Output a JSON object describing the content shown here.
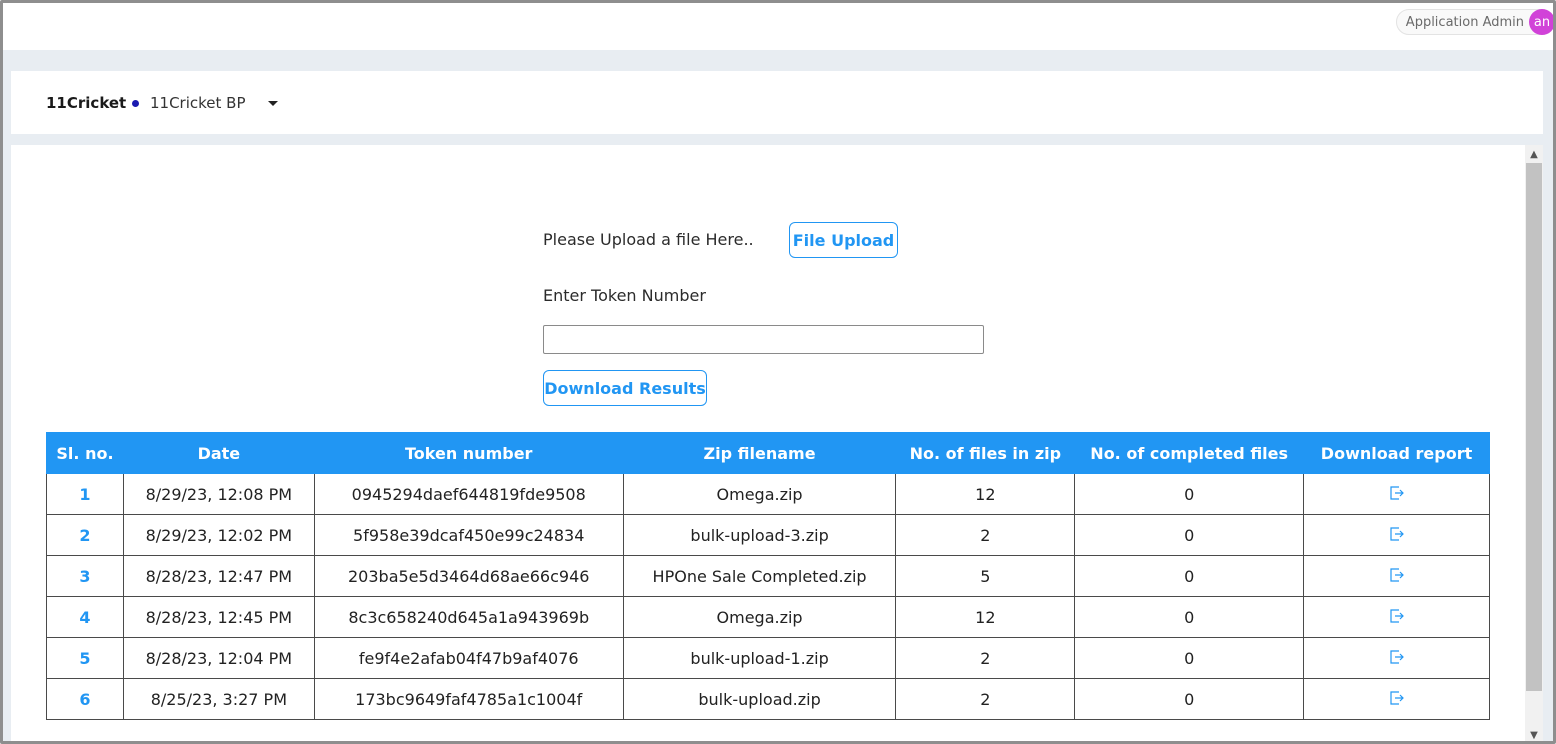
{
  "header": {
    "user_name": "Application Admin",
    "avatar_initials": "an"
  },
  "selector": {
    "brand": "11Cricket",
    "selected_bp": "11Cricket BP"
  },
  "upload": {
    "label": "Please Upload a file Here..",
    "button_label": "File Upload"
  },
  "token": {
    "label": "Enter Token Number",
    "value": "",
    "download_button_label": "Download Results"
  },
  "table": {
    "columns": [
      "Sl. no.",
      "Date",
      "Token number",
      "Zip filename",
      "No. of files in zip",
      "No. of completed files",
      "Download report"
    ],
    "rows": [
      {
        "sl": "1",
        "date": "8/29/23, 12:08 PM",
        "token": "0945294daef644819fde9508",
        "zip": "Omega.zip",
        "files": "12",
        "completed": "0"
      },
      {
        "sl": "2",
        "date": "8/29/23, 12:02 PM",
        "token": "5f958e39dcaf450e99c24834",
        "zip": "bulk-upload-3.zip",
        "files": "2",
        "completed": "0"
      },
      {
        "sl": "3",
        "date": "8/28/23, 12:47 PM",
        "token": "203ba5e5d3464d68ae66c946",
        "zip": "HPOne Sale Completed.zip",
        "files": "5",
        "completed": "0"
      },
      {
        "sl": "4",
        "date": "8/28/23, 12:45 PM",
        "token": "8c3c658240d645a1a943969b",
        "zip": "Omega.zip",
        "files": "12",
        "completed": "0"
      },
      {
        "sl": "5",
        "date": "8/28/23, 12:04 PM",
        "token": "fe9f4e2afab04f47b9af4076",
        "zip": "bulk-upload-1.zip",
        "files": "2",
        "completed": "0"
      },
      {
        "sl": "6",
        "date": "8/25/23, 3:27 PM",
        "token": "173bc9649faf4785a1c1004f",
        "zip": "bulk-upload.zip",
        "files": "2",
        "completed": "0"
      }
    ]
  },
  "colors": {
    "accent": "#2196f3",
    "avatar": "#d142d8",
    "page_band": "#e8edf2"
  },
  "icons": {
    "download_report": "export-icon",
    "dropdown": "caret-down-icon"
  }
}
